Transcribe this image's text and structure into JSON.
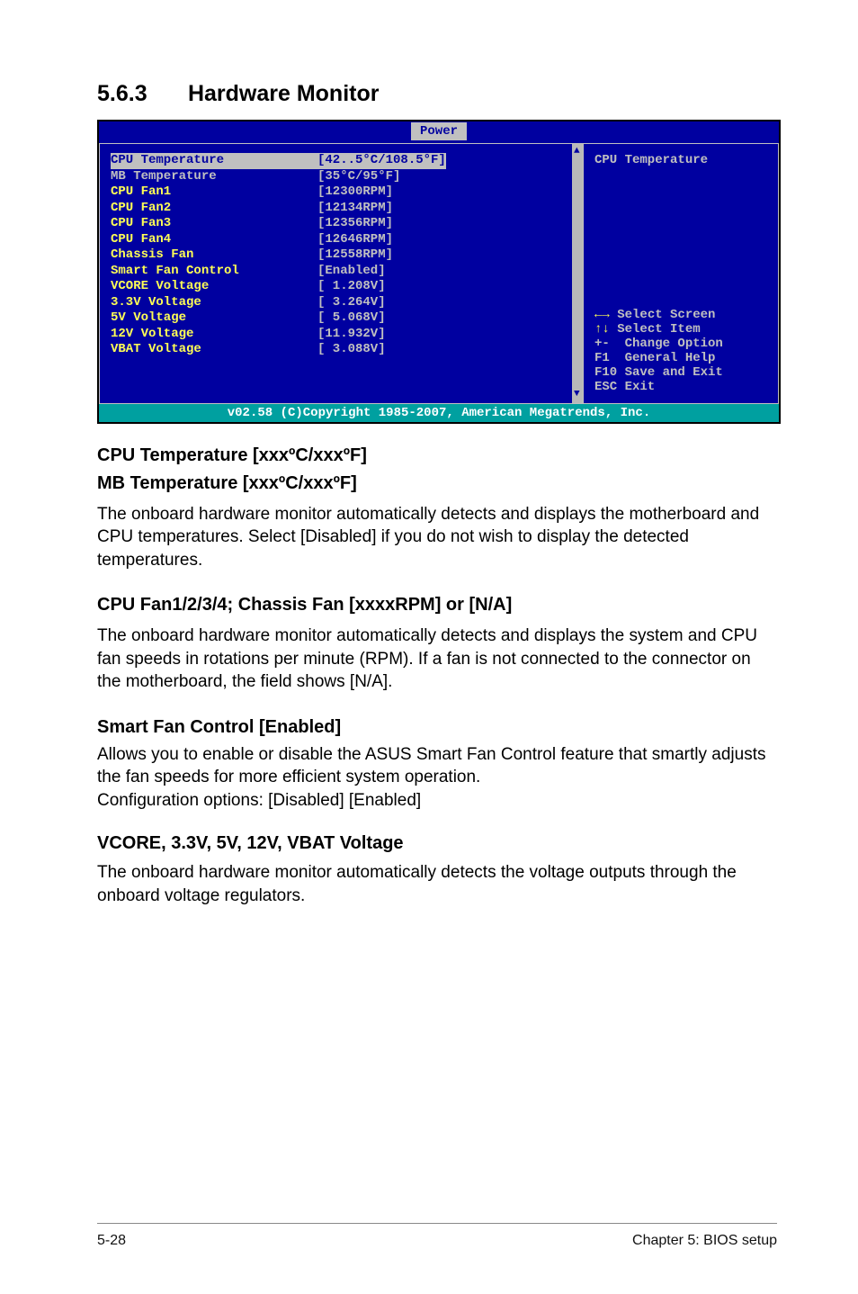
{
  "section": {
    "number": "5.6.3",
    "title": "Hardware Monitor"
  },
  "bios": {
    "tab": "Power",
    "rows": [
      {
        "label": "CPU Temperature",
        "value": "[42..5°C/108.5°F]",
        "highlight": true
      },
      {
        "label": "MB Temperature",
        "value": "[35°C/95°F]"
      },
      {
        "label": "",
        "value": ""
      },
      {
        "label": "CPU Fan1",
        "value": "[12300RPM]"
      },
      {
        "label": "CPU Fan2",
        "value": "[12134RPM]"
      },
      {
        "label": "CPU Fan3",
        "value": "[12356RPM]"
      },
      {
        "label": "CPU Fan4",
        "value": "[12646RPM]"
      },
      {
        "label": "Chassis Fan",
        "value": "[12558RPM]"
      },
      {
        "label": "Smart Fan Control",
        "value": "[Enabled]"
      },
      {
        "label": "",
        "value": ""
      },
      {
        "label": "VCORE Voltage",
        "value": "[ 1.208V]"
      },
      {
        "label": "3.3V Voltage",
        "value": "[ 3.264V]"
      },
      {
        "label": "5V Voltage",
        "value": "[ 5.068V]"
      },
      {
        "label": "12V Voltage",
        "value": "[11.932V]"
      },
      {
        "label": "VBAT Voltage",
        "value": "[ 3.088V]"
      }
    ],
    "help_title": "CPU Temperature",
    "help_lines": {
      "l1a": "←→",
      "l1b": " Select Screen",
      "l2a": "↑↓",
      "l2b": " Select Item",
      "l3": "+-  Change Option",
      "l4": "F1  General Help",
      "l5": "F10 Save and Exit",
      "l6": "ESC Exit"
    },
    "footer": "v02.58 (C)Copyright 1985-2007, American Megatrends, Inc."
  },
  "text": {
    "h1a": "CPU Temperature [xxxºC/xxxºF]",
    "h1b": "MB Temperature [xxxºC/xxxºF]",
    "p1": "The onboard hardware monitor automatically detects and displays the motherboard and CPU temperatures. Select [Disabled] if you do not wish to display the detected temperatures.",
    "h2": "CPU Fan1/2/3/4; Chassis Fan [xxxxRPM] or [N/A]",
    "p2": "The onboard hardware monitor automatically detects and displays the system and CPU fan speeds in rotations per minute (RPM). If a fan is not connected to the connector on the motherboard, the field shows [N/A].",
    "h3": "Smart Fan Control [Enabled]",
    "p3": "Allows you to enable or disable the ASUS Smart Fan Control feature that smartly adjusts the fan speeds for more efficient system operation.\nConfiguration options: [Disabled] [Enabled]",
    "h4": "VCORE, 3.3V, 5V, 12V, VBAT Voltage",
    "p4": "The onboard hardware monitor automatically detects the voltage outputs through the onboard voltage regulators."
  },
  "footer": {
    "left": "5-28",
    "right": "Chapter 5: BIOS setup"
  }
}
